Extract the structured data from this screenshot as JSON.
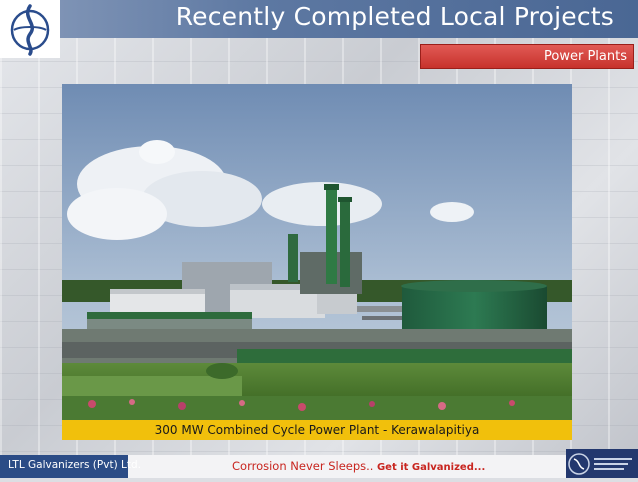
{
  "header": {
    "title": "Recently Completed Local Projects",
    "section_tab": "Power Plants"
  },
  "photo": {
    "subject": "power-plant-photo",
    "caption": "300 MW Combined Cycle Power Plant - Kerawalapitiya"
  },
  "footer": {
    "company": "LTL Galvanizers (Pvt) Ltd.",
    "tagline_a": "Corrosion Never Sleeps..",
    "tagline_b": " Get it Galvanized...",
    "badge_icon": "association-logo-icon"
  },
  "colors": {
    "title_band": "#5d78a2",
    "section_tab": "#c7322c",
    "caption_bar": "#f1c00c",
    "footer_left": "#2b4c86",
    "tagline": "#c8251f"
  }
}
